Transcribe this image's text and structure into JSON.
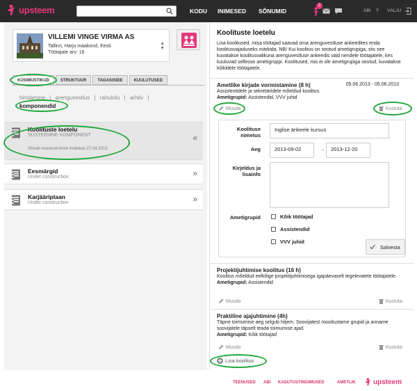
{
  "header": {
    "logo_text": "upsteem",
    "search_placeholder": "",
    "nav": [
      "KODU",
      "INIMESED",
      "SÕNUMID"
    ],
    "notification_count": "2",
    "abi": "ABI",
    "help": "?",
    "logout": "VÄLJU"
  },
  "company": {
    "name": "VILLEMI VINGE VIRMA AS",
    "address": "Tallinn, Harju maakond, Eesti",
    "employees": "Töötajate arv: 16"
  },
  "tabs": [
    "KÜSIMUSTIKUD",
    "STRUKTUUR",
    "TAGASISIDE",
    "KUULUTUSED"
  ],
  "subnav": {
    "items": [
      "hindamine",
      "|",
      "arenguvestlus",
      "|",
      "rahulolu",
      "|",
      "arhiiv",
      "|"
    ],
    "active": "komponendid"
  },
  "components": [
    {
      "title": "Koolituste loetelu",
      "subtitle": "SÜSTEEMNE KOMPONENT",
      "note": "Viimati muutnud Anne Andekas 27.04.2013",
      "chevron": "«"
    },
    {
      "title": "Eesmärgid",
      "subtitle": "Under construction",
      "chevron": "»"
    },
    {
      "title": "Karjääriplaan",
      "subtitle": "Under construction",
      "chevron": "»"
    }
  ],
  "right": {
    "title": "Koolituste loetelu",
    "intro": "Lisa koolitused, misa töötajad saavad oma arenguvestluse ankeedites enda koolitusvajaduseks märkida. NB! Kui koolitus on seotud ametigrupiga, siis see kuvatakse koolitusvalikuna arenguvestluse ankeedis vaid nendele töötajatele, kes kuuluvad sellesse ametigruppi. Koolitused, mis ei ole ametigrupiga seotud, kuvatakse kõikidele töötajatele.",
    "edit": "Muuda",
    "delete": "Kustuta",
    "courses": [
      {
        "title": "Ametlike kirjade vormistamine (8 h)",
        "date": "05.06.2013 - 05.06.2013",
        "desc": "Assistentidele ja sekretäridele mõeldud koolitus.",
        "groups_label": "Ametigrupid:",
        "groups": "Assistendid, VVV juhid"
      },
      {
        "title": "Projektijuhtimise koolitus (16 h)",
        "desc": "Koolitus mõeldud eelkõige projektijuhtimisega igapäevaselt tegelevatele töötajatele.",
        "groups_label": "Ametigrupid:",
        "groups": "Assistendid"
      },
      {
        "title": "Praktiline ajajuhtimine (4h)",
        "desc": "Täpne toimumise aeg selgub hiljem. Soovijatest moodustame grupid ja anname soovijatele täpselt teada toimumise ajad.",
        "groups_label": "Ametigrupid:",
        "groups": "Kõik töötajad"
      }
    ],
    "form": {
      "name_label": "Koolituse nimetus",
      "name_value": "Inglise ärikeele kursus",
      "time_label": "Aeg",
      "start": "2013-09-02",
      "dash": "-",
      "end": "2013-12-20",
      "desc_label": "Kirjeldus ja lisainfo",
      "groups_label": "Ametigrupid",
      "checks": [
        "Kõik töötajad",
        "Assistendid",
        "VVV juhid"
      ],
      "save": "Salvesta"
    },
    "add": "Lisa koolitus"
  },
  "footer": [
    "TEENUSED",
    "ABI",
    "KASUTUSTINGIMUSED",
    "AMETLIK"
  ],
  "footer_logo": "upsteem",
  "colors": {
    "brand": "#e5397b",
    "topbar": "#2a2a2a",
    "highlight": "#21a83c"
  }
}
